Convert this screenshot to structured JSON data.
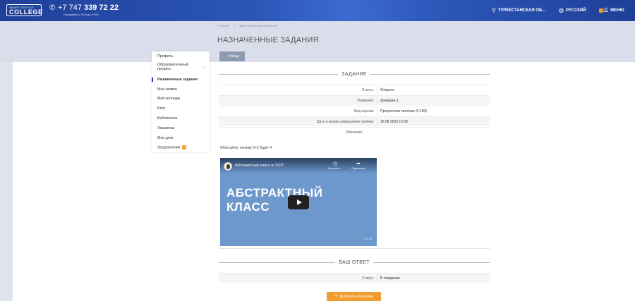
{
  "header": {
    "logo_small": "SMART SERVICE",
    "logo_main": "COLLEGE",
    "phone_prefix": "+7 747",
    "phone_main": "339 72 22",
    "hours": "Ежедневно с 9:00 до 21:00",
    "region": "ТУРКЕСТАНСКАЯ ОБ...",
    "language": "РУССКИЙ",
    "menu": "МЕНЮ"
  },
  "breadcrumbs": [
    "Главная",
    ">",
    "Дистанционное обучение"
  ],
  "page_title": "НАЗНАЧЕННЫЕ ЗАДАНИЯ",
  "back_label": "Назад",
  "sidebar": {
    "items": [
      {
        "label": "Профиль"
      },
      {
        "label": "Образовательный процесс"
      },
      {
        "label": "Назначенные задания"
      },
      {
        "label": "Мои заявки"
      },
      {
        "label": "Мой колледж"
      },
      {
        "label": "Блог"
      },
      {
        "label": "Библиотека"
      },
      {
        "label": "Экзамены"
      },
      {
        "label": "Мои дети"
      },
      {
        "label": "Уведомления",
        "badge": "0"
      }
    ]
  },
  "task": {
    "section_title": "ЗАДАНИЕ",
    "rows": [
      {
        "label": "Статус:",
        "value": "Открыто"
      },
      {
        "label": "Название:",
        "value": "Домашка 1"
      },
      {
        "label": "Вид оценки:",
        "value": "Процентная система (0-100)"
      },
      {
        "label": "Дата и время завершения приёма:",
        "value": "26.08.2020 12:00"
      }
    ],
    "description_label": "Описание:",
    "description_text": "Обоснуйте, почему 2+2 будет 4"
  },
  "video": {
    "title": "Абстрактный класс в ООП",
    "watch_later": "Смотреть ...",
    "share": "Поделиться",
    "big_line1": "АБСТРАКТНЫЙ",
    "big_line2": "КЛАСС",
    "cc": "CC-BY"
  },
  "answer": {
    "section_title": "ВАШ ОТВЕТ",
    "status_label": "Статус:",
    "status_value": "В ожидании",
    "add_button": "Добавить решение"
  },
  "colors": {
    "header_blue": "#1f3f98",
    "accent_orange": "#f29b2e",
    "back_button": "#8d9bb1"
  }
}
